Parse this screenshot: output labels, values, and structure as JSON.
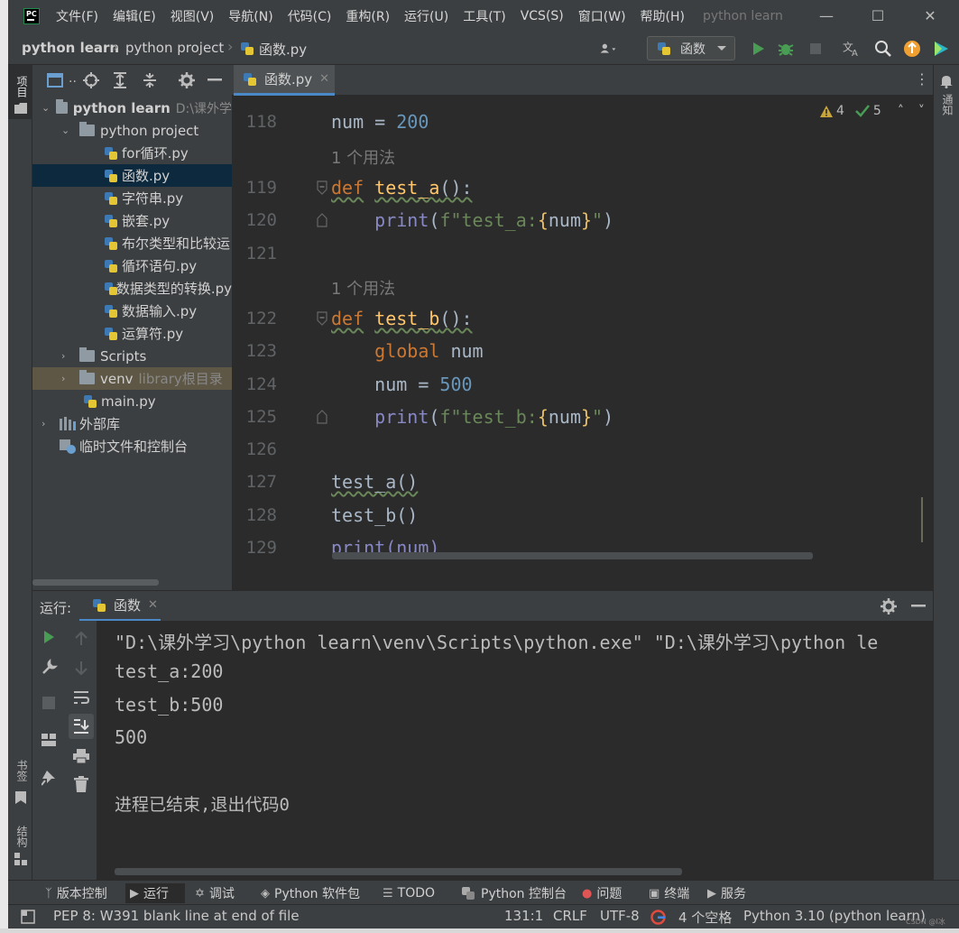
{
  "app": {
    "logo_text": "PC",
    "window_title": "python learn",
    "menu": [
      "文件(F)",
      "编辑(E)",
      "视图(V)",
      "导航(N)",
      "代码(C)",
      "重构(R)",
      "运行(U)",
      "工具(T)",
      "VCS(S)",
      "窗口(W)",
      "帮助(H)"
    ]
  },
  "breadcrumbs": [
    "python learn",
    "python project",
    "函数.py"
  ],
  "run_config": {
    "label": "函数"
  },
  "left_strip": {
    "project_label": "项目",
    "bookmarks_label": "书签",
    "structure_label": "结构"
  },
  "right_strip": {
    "notifications_label": "通知"
  },
  "project_toolbar": {
    "dots": ".."
  },
  "project_tree": {
    "root": {
      "label": "python learn",
      "path_hint": "D:\\课外学"
    },
    "project": {
      "label": "python project"
    },
    "files": [
      "for循环.py",
      "函数.py",
      "字符串.py",
      "嵌套.py",
      "布尔类型和比较运",
      "循环语句.py",
      "数据类型的转换.py",
      "数据输入.py",
      "运算符.py"
    ],
    "selected_file": "函数.py",
    "scripts": {
      "label": "Scripts"
    },
    "venv": {
      "label": "venv",
      "hint": "library根目录"
    },
    "main": {
      "label": "main.py"
    },
    "external_libs": {
      "label": "外部库"
    },
    "scratches": {
      "label": "临时文件和控制台"
    }
  },
  "editor": {
    "tab_label": "函数.py",
    "inspections": {
      "warnings": "4",
      "ok": "5"
    },
    "usage_hint": "1 个用法",
    "lines": [
      {
        "num": "118"
      },
      {
        "num": "119"
      },
      {
        "num": "120"
      },
      {
        "num": "121"
      },
      {
        "num": "122"
      },
      {
        "num": "123"
      },
      {
        "num": "124"
      },
      {
        "num": "125"
      },
      {
        "num": "126"
      },
      {
        "num": "127"
      },
      {
        "num": "128"
      },
      {
        "num": "129"
      }
    ],
    "tokens": {
      "num": "num",
      "eq": " = ",
      "v200": "200",
      "v500": "500",
      "def": "def",
      "test_a": "test_a",
      "test_b": "test_b",
      "parens_colon": "():",
      "print": "print",
      "global": "global",
      "str_a": "f\"test_a:",
      "str_b": "f\"test_b:",
      "call_a": "test_a()",
      "call_b": "test_b()",
      "print_num": "print(num)"
    }
  },
  "run_panel": {
    "label": "运行:",
    "tab_label": "函数",
    "console": [
      "\"D:\\课外学习\\python learn\\venv\\Scripts\\python.exe\" \"D:\\课外学习\\python le",
      "test_a:200",
      "test_b:500",
      "500",
      "",
      "进程已结束,退出代码0"
    ]
  },
  "bottom_tabs": [
    {
      "label": "版本控制",
      "icon": "branch-icon"
    },
    {
      "label": "运行",
      "icon": "play-icon"
    },
    {
      "label": "调试",
      "icon": "bug-icon"
    },
    {
      "label": "Python 软件包",
      "icon": "layers-icon"
    },
    {
      "label": "TODO",
      "icon": "list-icon"
    },
    {
      "label": "Python 控制台",
      "icon": "python-icon"
    },
    {
      "label": "问题",
      "icon": "error-icon"
    },
    {
      "label": "终端",
      "icon": "terminal-icon"
    },
    {
      "label": "服务",
      "icon": "services-icon"
    }
  ],
  "status": {
    "message": "PEP 8: W391 blank line at end of file",
    "position": "131:1",
    "line_sep": "CRLF",
    "encoding": "UTF-8",
    "indent": "4 个空格",
    "interpreter": "Python 3.10 (python learn)",
    "watermark": "CSDN @I冰"
  },
  "colors": {
    "keyword": "#cc7832",
    "function": "#ffc66d",
    "number": "#6897bb",
    "string": "#6a8759",
    "accent": "#4a88c7",
    "run_green": "#499c54"
  }
}
